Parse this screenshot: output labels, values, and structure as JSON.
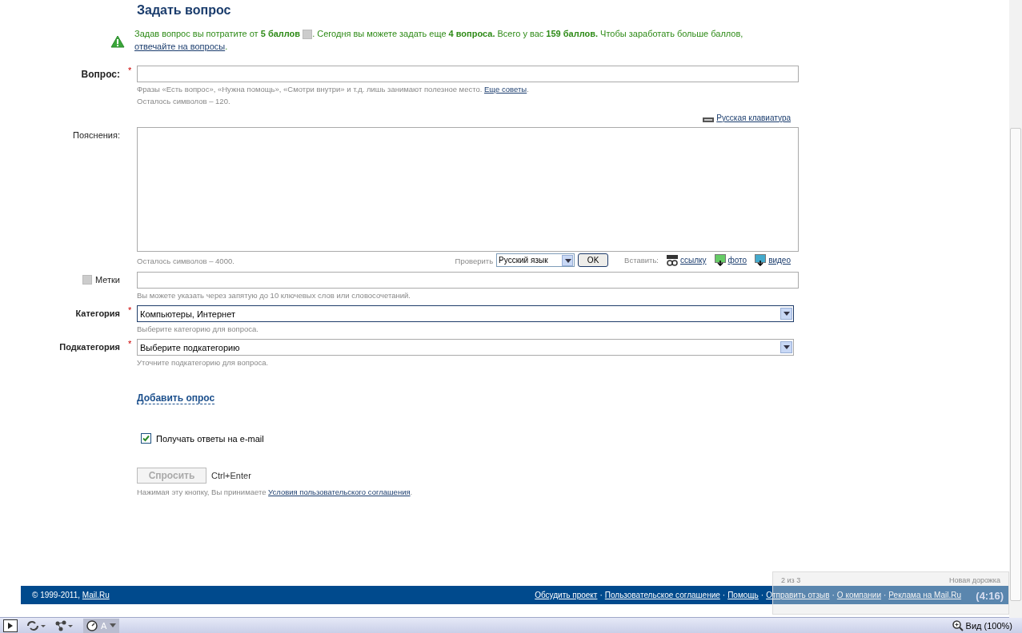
{
  "title": "Задать вопрос",
  "notice": {
    "part1": "Задав вопрос вы потратите от **5 баллов**",
    "part2": ". Сегодня вы можете задать еще **4 вопроса.** Всего у вас **159 баллов.** Чтобы заработать больше баллов, ",
    "link": "отвечайте на вопросы",
    "end": "."
  },
  "question": {
    "label": "Вопрос:",
    "required": true,
    "hint": "Фразы «Есть вопрос», «Нужна помощь», «Смотри внутри» и т.д. лишь занимают полезное место. ",
    "hint_link": "Еще советы",
    "hint_end": ".",
    "counter": "Осталось символов – 120."
  },
  "keyboard_link": "Русская клавиатура",
  "explanation": {
    "label": "Пояснения:",
    "counter": "Осталось символов – 4000.",
    "check_label": "Проверить",
    "language": "Русский язык",
    "ok": "OK",
    "insert_label": "Вставить:",
    "inserts": [
      {
        "kind": "link",
        "label": "ссылку"
      },
      {
        "kind": "photo",
        "label": "фото"
      },
      {
        "kind": "video",
        "label": "видео"
      }
    ]
  },
  "tags": {
    "label": "Метки",
    "hint": "Вы можете указать через запятую до 10 ключевых слов или словосочетаний."
  },
  "selects": [
    {
      "label": "Категория",
      "required": true,
      "value": "Компьютеры, Интернет",
      "hint": "Выберите категорию для вопроса.",
      "focused": true
    },
    {
      "label": "Подкатегория",
      "required": true,
      "value": "Выберите подкатегорию",
      "hint": "Уточните подкатегорию для вопроса.",
      "focused": false
    }
  ],
  "poll_link": "Добавить опрос",
  "email": {
    "label": "Получать ответы на e-mail",
    "checked": true
  },
  "submit": {
    "label": "Спросить",
    "disabled": true,
    "shortcut": "Ctrl+Enter"
  },
  "terms": {
    "text": "Нажимая эту кнопку, Вы принимаете ",
    "link": "Условия пользовательского соглашения",
    "end": "."
  },
  "footer": {
    "copyright": "© 1999-2011, ",
    "site_link": "Mail.Ru",
    "separator": "·",
    "links": [
      "Обсудить проект",
      "Пользовательское соглашение",
      "Помощь",
      "Отправить отзыв",
      "О компании",
      "Реклама на Mail.Ru"
    ]
  },
  "required_mark": "*",
  "popup": {
    "counter": "2 из 3",
    "title": "Новая дорожка",
    "time": "(4:16)"
  },
  "status_bar": {
    "letter": "A",
    "zoom": "Вид (100%)"
  }
}
